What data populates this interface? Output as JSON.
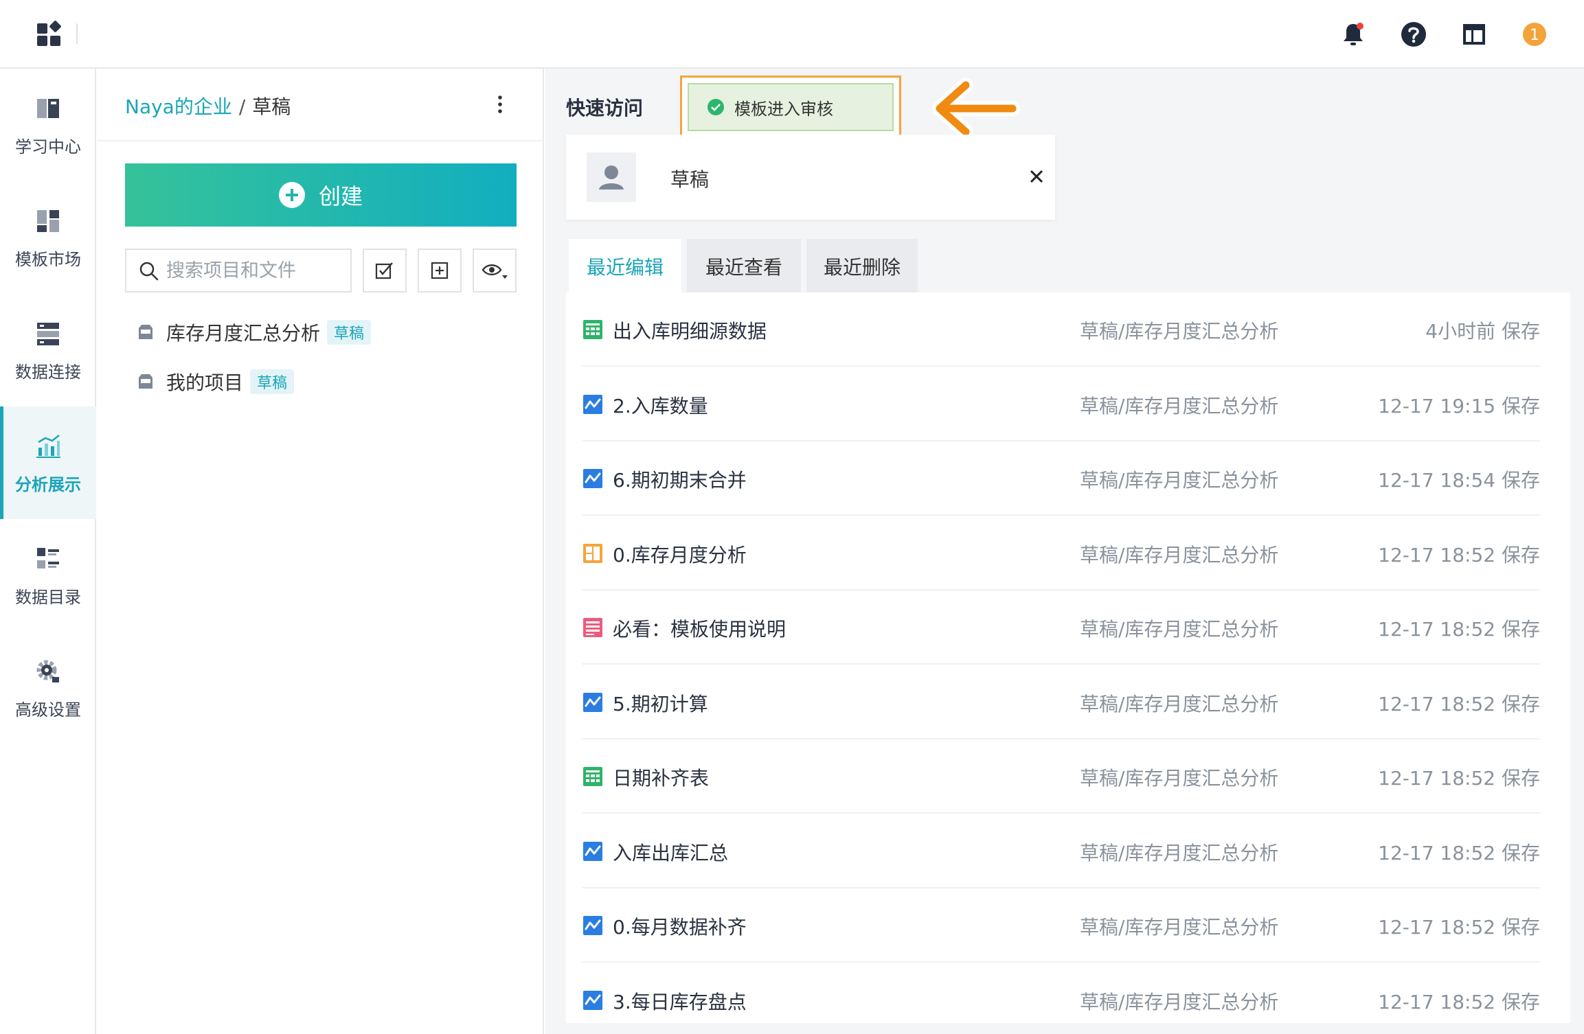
{
  "colors": {
    "accent": "#1aa5b8",
    "create_gradient_start": "#35c29a",
    "create_gradient_end": "#12aec0",
    "toast_bg": "#e6f2df",
    "toast_success": "#2eb56e",
    "highlight_orange": "#f5a43c",
    "bell_notification_dot": "#e8453c",
    "user_badge": "#f2a33a"
  },
  "topbar": {
    "icons": [
      "apps-grid-icon",
      "bell-icon",
      "help-icon",
      "layout-icon",
      "user-badge-icon"
    ],
    "user_badge_text": "1"
  },
  "rail": {
    "items": [
      {
        "label": "学习中心",
        "icon": "book-icon",
        "active": false
      },
      {
        "label": "模板市场",
        "icon": "template-icon",
        "active": false
      },
      {
        "label": "数据连接",
        "icon": "data-connect-icon",
        "active": false
      },
      {
        "label": "分析展示",
        "icon": "chart-icon",
        "active": true
      },
      {
        "label": "数据目录",
        "icon": "catalog-icon",
        "active": false
      },
      {
        "label": "高级设置",
        "icon": "gear-icon",
        "active": false
      }
    ]
  },
  "panel": {
    "breadcrumb": {
      "root": "Naya的企业",
      "separator": "/",
      "current": "草稿"
    },
    "create_label": "创建",
    "search": {
      "placeholder": "搜索项目和文件",
      "value": ""
    },
    "projects": [
      {
        "name": "库存月度汇总分析",
        "badge": "草稿"
      },
      {
        "name": "我的项目",
        "badge": "草稿"
      }
    ]
  },
  "main": {
    "quick_access_title": "快速访问",
    "toast_text": "模板进入审核",
    "quick_card": {
      "name": "草稿"
    },
    "tabs": [
      {
        "label": "最近编辑",
        "active": true
      },
      {
        "label": "最近查看",
        "active": false
      },
      {
        "label": "最近删除",
        "active": false
      }
    ],
    "files": [
      {
        "name": "出入库明细源数据",
        "path": "草稿/库存月度汇总分析",
        "time": "4小时前 保存",
        "type": "table"
      },
      {
        "name": "2.入库数量",
        "path": "草稿/库存月度汇总分析",
        "time": "12-17 19:15 保存",
        "type": "flow"
      },
      {
        "name": "6.期初期末合并",
        "path": "草稿/库存月度汇总分析",
        "time": "12-17 18:54 保存",
        "type": "flow"
      },
      {
        "name": "0.库存月度分析",
        "path": "草稿/库存月度汇总分析",
        "time": "12-17 18:52 保存",
        "type": "dashboard"
      },
      {
        "name": "必看：模板使用说明",
        "path": "草稿/库存月度汇总分析",
        "time": "12-17 18:52 保存",
        "type": "doc"
      },
      {
        "name": "5.期初计算",
        "path": "草稿/库存月度汇总分析",
        "time": "12-17 18:52 保存",
        "type": "flow"
      },
      {
        "name": "日期补齐表",
        "path": "草稿/库存月度汇总分析",
        "time": "12-17 18:52 保存",
        "type": "table"
      },
      {
        "name": "入库出库汇总",
        "path": "草稿/库存月度汇总分析",
        "time": "12-17 18:52 保存",
        "type": "flow"
      },
      {
        "name": "0.每月数据补齐",
        "path": "草稿/库存月度汇总分析",
        "time": "12-17 18:52 保存",
        "type": "flow"
      },
      {
        "name": "3.每日库存盘点",
        "path": "草稿/库存月度汇总分析",
        "time": "12-17 18:52 保存",
        "type": "flow"
      }
    ]
  }
}
